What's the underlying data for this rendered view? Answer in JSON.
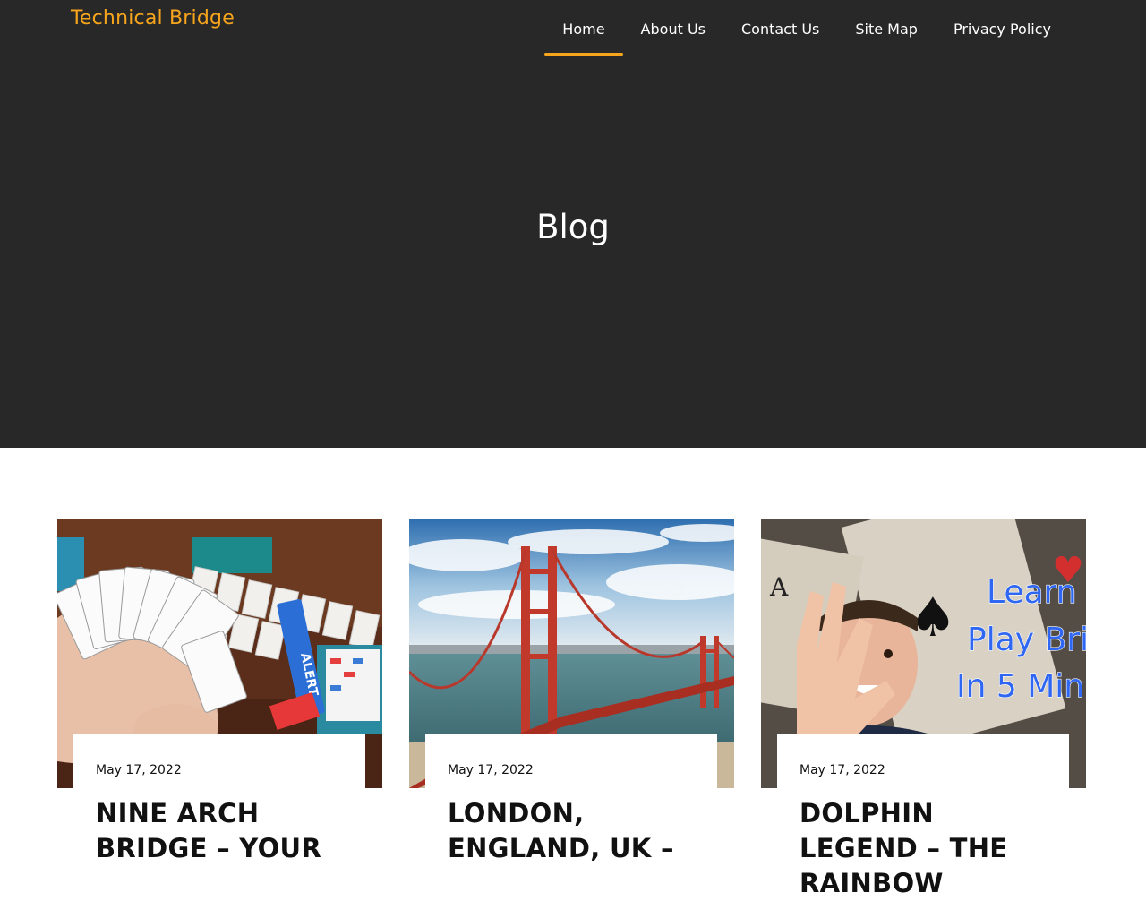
{
  "site": {
    "title": "Technical Bridge",
    "accent_color": "#f7a51c",
    "header_bg": "#282828"
  },
  "nav": {
    "items": [
      {
        "label": "Home",
        "active": true
      },
      {
        "label": "About Us",
        "active": false
      },
      {
        "label": "Contact Us",
        "active": false
      },
      {
        "label": "Site Map",
        "active": false
      },
      {
        "label": "Privacy Policy",
        "active": false
      }
    ]
  },
  "hero": {
    "title": "Blog"
  },
  "posts": [
    {
      "date": "May 17, 2022",
      "title": "NINE ARCH BRIDGE – YOUR",
      "image": "bridge-cards-photo",
      "image_text": "ALERT"
    },
    {
      "date": "May 17, 2022",
      "title": "LONDON, ENGLAND, UK –",
      "image": "golden-gate-bridge-photo"
    },
    {
      "date": "May 17, 2022",
      "title": "DOLPHIN LEGEND – THE RAINBOW",
      "image": "learn-bridge-video-thumbnail",
      "image_text": [
        "Learn T",
        "Play Bric",
        "In 5 Min"
      ]
    }
  ]
}
